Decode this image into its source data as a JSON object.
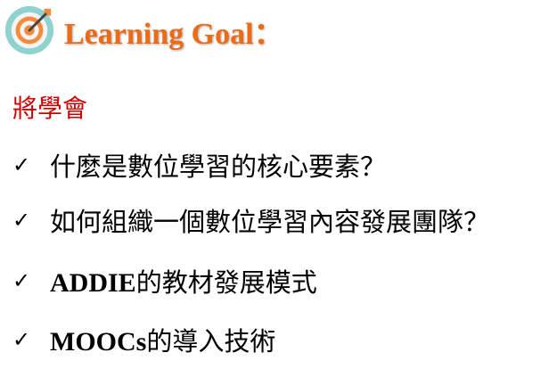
{
  "header": {
    "title": "Learning Goal",
    "title_suffix": "：",
    "icon": "target-icon",
    "title_color": "#ee6a14"
  },
  "subtitle": {
    "text": "將學會",
    "color": "#cc0000"
  },
  "goals": [
    {
      "check": "✓",
      "latin": "",
      "text": "什麼是數位學習的核心要素？"
    },
    {
      "check": "✓",
      "latin": "",
      "text": "如何組織一個數位學習內容發展團隊？"
    },
    {
      "check": "✓",
      "latin": "ADDIE",
      "text": "的教材發展模式"
    },
    {
      "check": "✓",
      "latin": "MOOCs",
      "text": "的導入技術"
    }
  ]
}
